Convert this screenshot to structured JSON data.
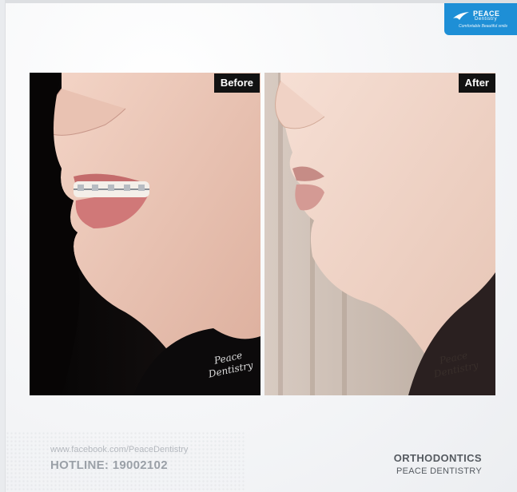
{
  "logo": {
    "name": "PEACE",
    "sub": "Dentistry",
    "tagline": "Comfortable Beautiful smile",
    "icon": "bird-logo-icon"
  },
  "panels": {
    "before_label": "Before",
    "after_label": "After",
    "watermark_line1": "Peace",
    "watermark_line2": "Dentistry"
  },
  "footer": {
    "url": "www.facebook.com/PeaceDentistry",
    "hotline": "HOTLINE: 19002102",
    "service": "ORTHODONTICS",
    "brand": "PEACE DENTISTRY"
  },
  "colors": {
    "brand_blue": "#1e8fd6",
    "label_bg": "#121212"
  }
}
